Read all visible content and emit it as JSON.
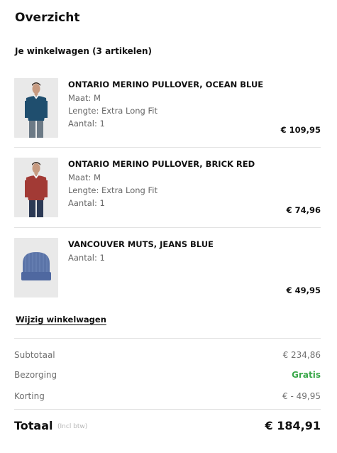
{
  "overview": {
    "title": "Overzicht"
  },
  "cart": {
    "heading": "Je winkelwagen (3 artikelen)",
    "items": [
      {
        "name": "ONTARIO MERINO PULLOVER, OCEAN BLUE",
        "size": "Maat: M",
        "length": "Lengte: Extra Long Fit",
        "quantity": "Aantal: 1",
        "price": "€ 109,95",
        "image": "model-wearing-ocean-blue-pullover",
        "color": "#1f4e6e"
      },
      {
        "name": "ONTARIO MERINO PULLOVER, BRICK RED",
        "size": "Maat: M",
        "length": "Lengte: Extra Long Fit",
        "quantity": "Aantal: 1",
        "price": "€ 74,96",
        "image": "model-wearing-brick-red-pullover",
        "color": "#a23a35"
      },
      {
        "name": "VANCOUVER MUTS, JEANS BLUE",
        "quantity": "Aantal: 1",
        "price": "€ 49,95",
        "image": "jeans-blue-beanie",
        "color": "#5b74a8"
      }
    ],
    "edit_link": "Wijzig winkelwagen"
  },
  "summary": {
    "subtotal_label": "Subtotaal",
    "subtotal_value": "€ 234,86",
    "shipping_label": "Bezorging",
    "shipping_value": "Gratis",
    "discount_label": "Korting",
    "discount_value": "€ - 49,95",
    "total_label": "Totaal",
    "total_note": "(Incl btw)",
    "total_value": "€ 184,91",
    "free_color": "#3aa84a"
  }
}
